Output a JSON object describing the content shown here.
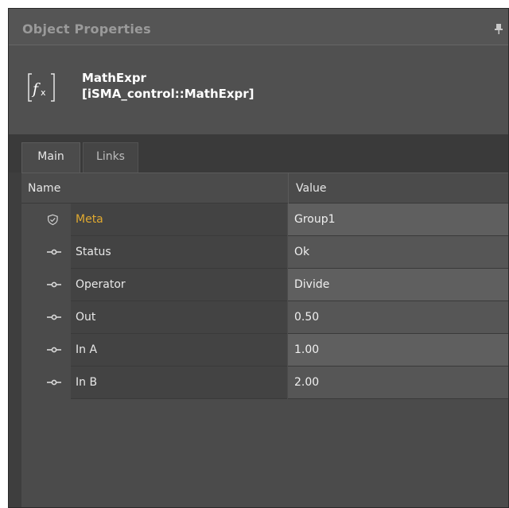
{
  "panel": {
    "title": "Object Properties",
    "pin_icon": "pin-icon"
  },
  "object": {
    "icon": "fx-icon",
    "name": "MathExpr",
    "type": "[iSMA_control::MathExpr]"
  },
  "tabs": [
    {
      "label": "Main",
      "selected": true
    },
    {
      "label": "Links",
      "selected": false
    }
  ],
  "table": {
    "columns": {
      "name": "Name",
      "value": "Value"
    },
    "rows": [
      {
        "icon": "shield-icon",
        "name": "Meta",
        "value": "Group1",
        "highlight_color": "#e0a930"
      },
      {
        "icon": "slot-icon",
        "name": "Status",
        "value": "Ok"
      },
      {
        "icon": "slot-icon",
        "name": "Operator",
        "value": "Divide"
      },
      {
        "icon": "slot-icon",
        "name": "Out",
        "value": "0.50"
      },
      {
        "icon": "slot-icon",
        "name": "In A",
        "value": "1.00"
      },
      {
        "icon": "slot-icon",
        "name": "In B",
        "value": "2.00"
      }
    ]
  },
  "colors": {
    "panel_bg": "#3e3e3e",
    "title_bar": "#555555",
    "meta_accent": "#e0a930"
  }
}
